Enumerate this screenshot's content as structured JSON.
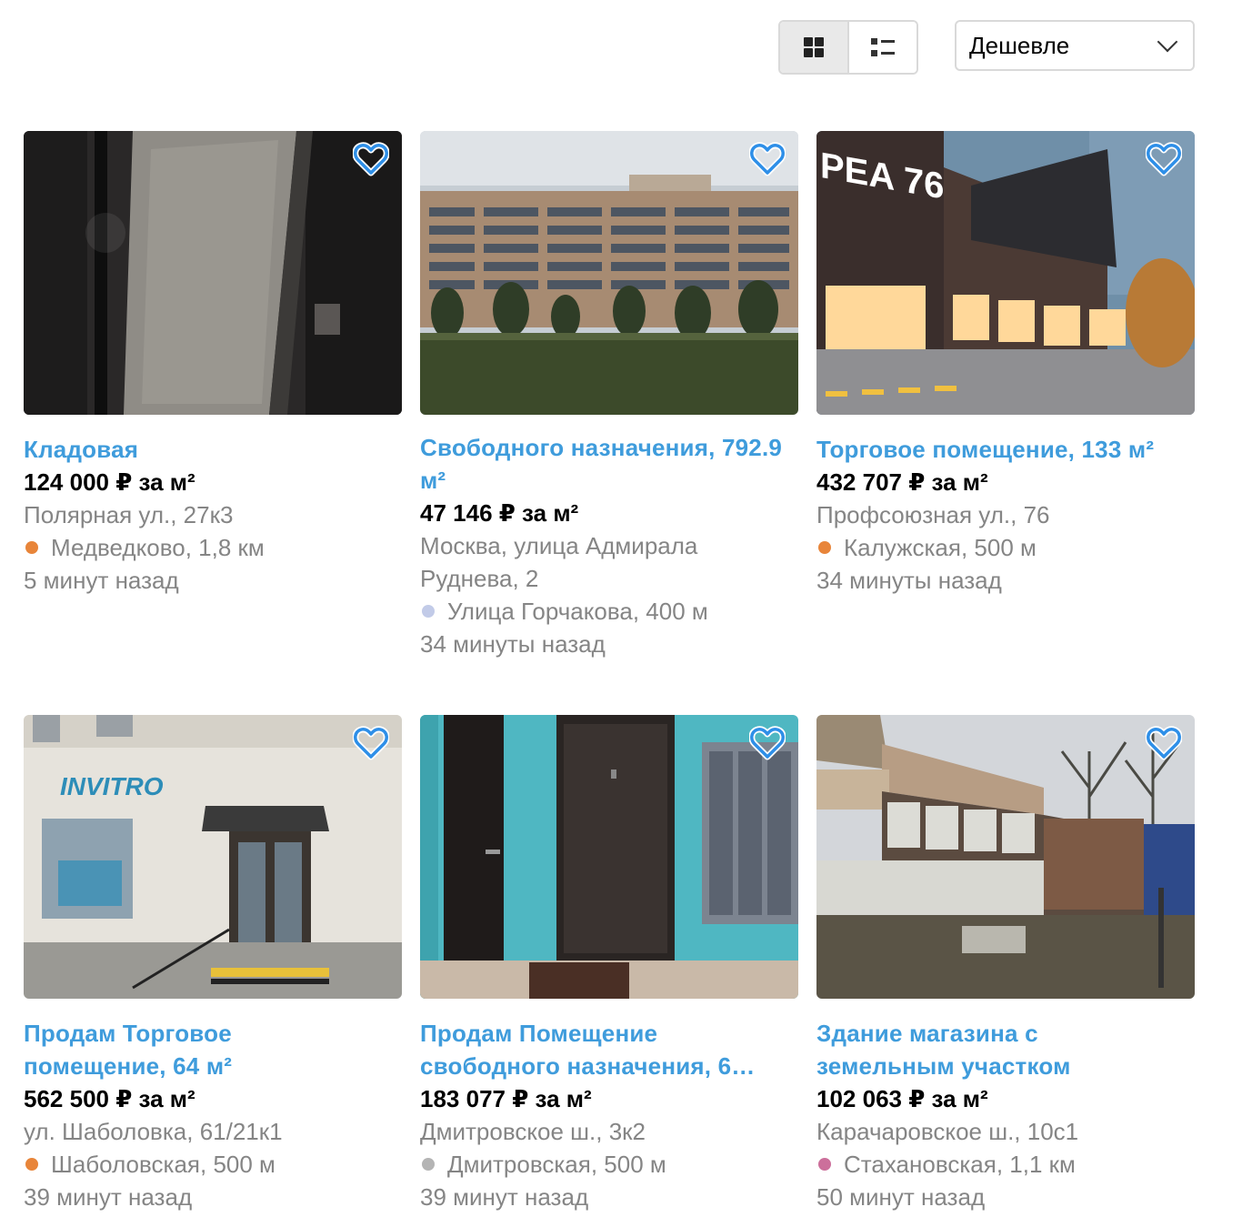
{
  "toolbar": {
    "grid_view_icon": "grid-icon",
    "list_view_icon": "list-icon",
    "sort_value": "Дешевле"
  },
  "colors": {
    "link": "#3f9cdc",
    "muted": "#858585"
  },
  "listings": [
    {
      "title": "Кладовая",
      "price": "124 000 ₽ за м²",
      "address": "Полярная ул., 27к3",
      "metro": "Медведково, 1,8 км",
      "metro_color": "#e8853a",
      "time": "5 минут назад"
    },
    {
      "title": "Свободного назначения, 792.9 м²",
      "price": "47 146 ₽ за м²",
      "address": "Москва, улица Адмирала Руднева, 2",
      "metro": "Улица Горчакова, 400 м",
      "metro_color": "#c2cbe8",
      "time": "34 минуты назад"
    },
    {
      "title": "Торговое помещение, 133 м²",
      "price": "432 707 ₽ за м²",
      "address": "Профсоюзная ул., 76",
      "metro": "Калужская, 500 м",
      "metro_color": "#e8853a",
      "time": "34 минуты назад"
    },
    {
      "title": "Продам Торговое помещение, 64 м²",
      "price": "562 500 ₽ за м²",
      "address": "ул. Шаболовка, 61/21к1",
      "metro": "Шаболовская, 500 м",
      "metro_color": "#e8853a",
      "time": "39 минут назад"
    },
    {
      "title": "Продам Помещение свободного назначения, 6…",
      "price": "183 077 ₽ за м²",
      "address": "Дмитровское ш., 3к2",
      "metro": "Дмитровская, 500 м",
      "metro_color": "#b4b4b4",
      "time": "39 минут назад"
    },
    {
      "title": "Здание магазина с земельным участком",
      "price": "102 063 ₽ за м²",
      "address": "Карачаровское ш., 10с1",
      "metro": "Стахановская, 1,1 км",
      "metro_color": "#cc6f9b",
      "time": "50 минут назад"
    }
  ]
}
